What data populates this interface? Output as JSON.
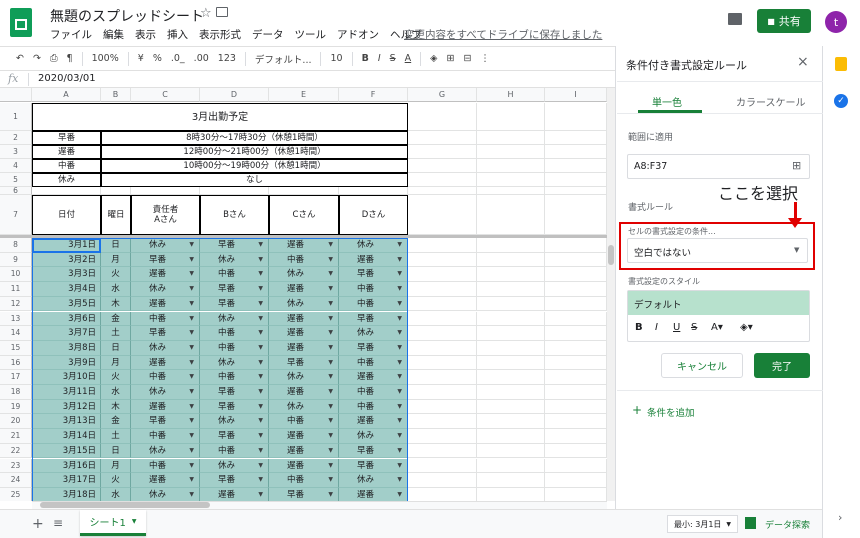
{
  "app": {
    "doc_title": "無題のスプレッドシート",
    "menu": [
      "ファイル",
      "編集",
      "表示",
      "挿入",
      "表示形式",
      "データ",
      "ツール",
      "アドオン",
      "ヘルプ"
    ],
    "saved_msg": "変更内容をすべてドライブに保存しました",
    "share_label": "共有",
    "avatar_letter": "t"
  },
  "toolbar": {
    "zoom": "100%",
    "currency": "¥",
    "percent": "%",
    "dec_minus": ".0_",
    "dec_plus": ".00",
    "num_format": "123",
    "font": "デフォルト...",
    "font_size": "10",
    "bold": "B",
    "italic": "I",
    "strike": "S",
    "textcolor": "A"
  },
  "formula": {
    "fx": "fx",
    "value": "2020/03/01"
  },
  "columns": [
    "A",
    "B",
    "C",
    "D",
    "E",
    "F",
    "G",
    "H",
    "I"
  ],
  "rows": [
    "1",
    "2",
    "3",
    "4",
    "5",
    "6",
    "7",
    "8",
    "9",
    "10",
    "11",
    "12",
    "13",
    "14",
    "15",
    "16",
    "17",
    "18",
    "19",
    "20",
    "21",
    "22",
    "23",
    "24",
    "25"
  ],
  "sheet": {
    "title": "3月出勤予定",
    "shifts": [
      {
        "name": "早番",
        "time": "8時30分～17時30分（休憩1時間）"
      },
      {
        "name": "遅番",
        "time": "12時00分～21時00分（休憩1時間）"
      },
      {
        "name": "中番",
        "time": "10時00分～19時00分（休憩1時間）"
      },
      {
        "name": "休み",
        "time": "なし"
      }
    ],
    "headers": [
      "日付",
      "曜日",
      "責任者\nAさん",
      "Bさん",
      "Cさん",
      "Dさん"
    ],
    "data": [
      [
        "3月1日",
        "日",
        "休み",
        "早番",
        "遅番",
        "休み"
      ],
      [
        "3月2日",
        "月",
        "早番",
        "休み",
        "中番",
        "遅番"
      ],
      [
        "3月3日",
        "火",
        "遅番",
        "中番",
        "休み",
        "早番"
      ],
      [
        "3月4日",
        "水",
        "休み",
        "早番",
        "遅番",
        "中番"
      ],
      [
        "3月5日",
        "木",
        "遅番",
        "早番",
        "休み",
        "中番"
      ],
      [
        "3月6日",
        "金",
        "中番",
        "休み",
        "遅番",
        "早番"
      ],
      [
        "3月7日",
        "土",
        "早番",
        "中番",
        "遅番",
        "休み"
      ],
      [
        "3月8日",
        "日",
        "休み",
        "中番",
        "遅番",
        "早番"
      ],
      [
        "3月9日",
        "月",
        "遅番",
        "休み",
        "早番",
        "中番"
      ],
      [
        "3月10日",
        "火",
        "中番",
        "中番",
        "休み",
        "遅番"
      ],
      [
        "3月11日",
        "水",
        "休み",
        "早番",
        "遅番",
        "中番"
      ],
      [
        "3月12日",
        "木",
        "遅番",
        "早番",
        "休み",
        "中番"
      ],
      [
        "3月13日",
        "金",
        "早番",
        "休み",
        "中番",
        "遅番"
      ],
      [
        "3月14日",
        "土",
        "中番",
        "早番",
        "遅番",
        "休み"
      ],
      [
        "3月15日",
        "日",
        "休み",
        "中番",
        "遅番",
        "早番"
      ],
      [
        "3月16日",
        "月",
        "中番",
        "休み",
        "遅番",
        "早番"
      ],
      [
        "3月17日",
        "火",
        "遅番",
        "早番",
        "中番",
        "休み"
      ],
      [
        "3月18日",
        "水",
        "休み",
        "遅番",
        "早番",
        "遅番"
      ]
    ]
  },
  "panel": {
    "title": "条件付き書式設定ルール",
    "tab_single": "単一色",
    "tab_scale": "カラースケール",
    "range_label": "範囲に適用",
    "range_value": "A8:F37",
    "rules_label": "書式ルール",
    "condition_label": "セルの書式設定の条件...",
    "condition_value": "空白ではない",
    "style_label": "書式設定のスタイル",
    "style_preview": "デフォルト",
    "cancel": "キャンセル",
    "done": "完了",
    "add_rule": "条件を追加",
    "annotation": "ここを選択"
  },
  "bottom": {
    "sheet_tab": "シート1",
    "summary": "最小: 3月1日",
    "explore": "データ探索"
  },
  "colors": {
    "accent": "#188038",
    "teal": "#a2cec9",
    "highlight": "#e00000"
  }
}
